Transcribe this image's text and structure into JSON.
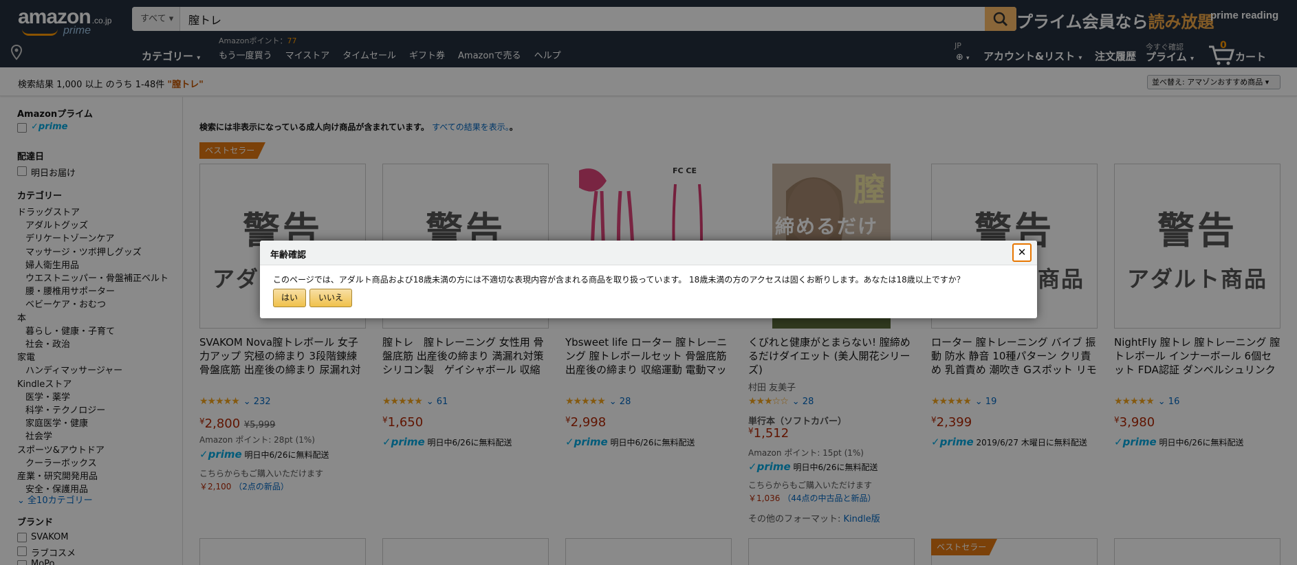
{
  "header": {
    "logo_text": "amazon",
    "logo_tld": ".co.jp",
    "logo_sub": "prime",
    "search_category": "すべて",
    "search_query": "膣トレ",
    "promo_text": "プライム会員なら",
    "promo_highlight": "読み放題",
    "prime_reading": "prime reading",
    "categories_label": "カテゴリー",
    "points_label": "Amazonポイント：",
    "points_value": "77",
    "nav_links": [
      "もう一度買う",
      "マイストア",
      "タイムセール",
      "ギフト券",
      "Amazonで売る",
      "ヘルプ"
    ],
    "lang": "JP",
    "account_label": "アカウント&リスト",
    "orders_label": "注文履歴",
    "prime_small": "今すぐ確認",
    "prime_label": "プライム",
    "cart_count": "0",
    "cart_label": "カート"
  },
  "subheader": {
    "results_text": "検索結果 1,000 以上 のうち 1-48件",
    "results_query": "\"膣トレ\"",
    "sort_label": "並べ替え: アマゾンおすすめ商品"
  },
  "sidebar": {
    "prime_heading": "Amazonプライム",
    "prime_badge": "✓prime",
    "delivery_heading": "配達日",
    "delivery_option": "明日お届け",
    "category_heading": "カテゴリー",
    "categories": [
      {
        "label": "ドラッグストア",
        "indent": 0
      },
      {
        "label": "アダルトグッズ",
        "indent": 1
      },
      {
        "label": "デリケートゾーンケア",
        "indent": 1
      },
      {
        "label": "マッサージ・ツボ押しグッズ",
        "indent": 1
      },
      {
        "label": "婦人衛生用品",
        "indent": 1
      },
      {
        "label": "ウエストニッパー・骨盤補正ベルト",
        "indent": 1
      },
      {
        "label": "腰・腰椎用サポーター",
        "indent": 1
      },
      {
        "label": "ベビーケア・おむつ",
        "indent": 1
      },
      {
        "label": "本",
        "indent": 0
      },
      {
        "label": "暮らし・健康・子育て",
        "indent": 1
      },
      {
        "label": "社会・政治",
        "indent": 1
      },
      {
        "label": "家電",
        "indent": 0
      },
      {
        "label": "ハンディマッサージャー",
        "indent": 1
      },
      {
        "label": "Kindleストア",
        "indent": 0
      },
      {
        "label": "医学・薬学",
        "indent": 1
      },
      {
        "label": "科学・テクノロジー",
        "indent": 1
      },
      {
        "label": "家庭医学・健康",
        "indent": 1
      },
      {
        "label": "社会学",
        "indent": 1
      },
      {
        "label": "スポーツ&アウトドア",
        "indent": 0
      },
      {
        "label": "クーラーボックス",
        "indent": 1
      },
      {
        "label": "産業・研究開発用品",
        "indent": 0
      },
      {
        "label": "安全・保護用品",
        "indent": 1
      }
    ],
    "more_categories": "全10カテゴリー",
    "brand_heading": "ブランド",
    "brands": [
      "SVAKOM",
      "ラブコスメ",
      "MoPo"
    ]
  },
  "main": {
    "notice_text": "検索には非表示になっている成人向け商品が含まれています。",
    "notice_link": "すべての結果を表示。",
    "notice_tail": "。",
    "bestseller_label": "ベストセラー",
    "warning_big": "警告",
    "warning_small": "アダルト商品",
    "products": [
      {
        "title": "SVAKOM Nova膣トレボール 女子力アップ 究極の締まり 3段階錬練 骨盤底筋 出産後の締まり 尿漏れ対策 医療用シリコン 完全防水 膣トレボール",
        "rating": 4.5,
        "stars": "★★★★★",
        "reviews": "232",
        "price": "2,800",
        "list_price": "¥5,999",
        "points": "Amazon ポイント: 28pt (1%)",
        "prime": "prime",
        "delivery": "明日中6/26に無料配送",
        "other_text": "こちらからもご購入いただけます",
        "other_price": "￥2,100",
        "other_link": "（2点の新品）"
      },
      {
        "title": "膣トレ　膣トレーニング 女性用 骨盤底筋 出産後の締まり 満漏れ対策 シリコン製　ゲイシャボール 収縮運動 膣トレボール",
        "rating": 4.5,
        "stars": "★★★★★",
        "reviews": "61",
        "price": "1,650",
        "prime": "prime",
        "delivery": "明日中6/26に無料配送"
      },
      {
        "title": "Ybsweet life ローター 膣トレーニング 膣トレボールセット 骨盤底筋 出産後の締まり 収縮運動 電動マッサージ器 強力振動 遠隔操作 超静音",
        "rating": 5,
        "stars": "★★★★★",
        "reviews": "28",
        "price": "2,998",
        "prime": "prime",
        "delivery": "明日中6/26に無料配送"
      },
      {
        "title": "くびれと健康がとまらない! 膣締めるだけダイエット (美人開花シリーズ)",
        "author": "村田 友美子",
        "rating": 3,
        "stars": "★★★☆☆",
        "reviews": "28",
        "format": "単行本（ソフトカバー）",
        "price": "1,512",
        "points": "Amazon ポイント: 15pt (1%)",
        "prime": "prime",
        "delivery": "明日中6/26に無料配送",
        "other_text": "こちらからもご購入いただけます",
        "other_price": "￥1,036",
        "other_link": "（44点の中古品と新品）",
        "other_format_label": "その他のフォーマット:",
        "other_format_link": "Kindle版",
        "cover_title": "膣",
        "cover_sub": "締めるだけ"
      },
      {
        "title": "ローター 膣トレーニング バイブ 振動 防水 静音 10種パターン クリ責め 乳首責め 潮吹き Gスポット リモコン操作 骨盤底筋 出産後の締まり",
        "rating": 5,
        "stars": "★★★★★",
        "reviews": "19",
        "price": "2,399",
        "prime": "prime",
        "delivery": "2019/6/27 木曜日に無料配送"
      },
      {
        "title": "NightFly 膣トレ 膣トレーニング 膣トレボール インナーボール 6個セット FDA認証 ダンベルシュリンク 骨盤底筋 出産後の締まり シリコン",
        "rating": 4.5,
        "stars": "★★★★★",
        "reviews": "16",
        "price": "3,980",
        "prime": "prime",
        "delivery": "明日中6/26に無料配送"
      }
    ],
    "toy_marks": "FC CE"
  },
  "modal": {
    "title": "年齢確認",
    "close": "✕",
    "message": "このページでは、アダルト商品および18歳未満の方には不適切な表現内容が含まれる商品を取り扱っています。 18歳未満の方のアクセスは固くお断りします。あなたは18歳以上ですか？",
    "yes_label": "はい",
    "no_label": "いいえ"
  },
  "colors": {
    "nav_bg": "#232f3e",
    "accent": "#febd69",
    "price": "#b12704",
    "link": "#0066c0",
    "prime": "#00a8e1",
    "bestseller": "#e47911"
  }
}
